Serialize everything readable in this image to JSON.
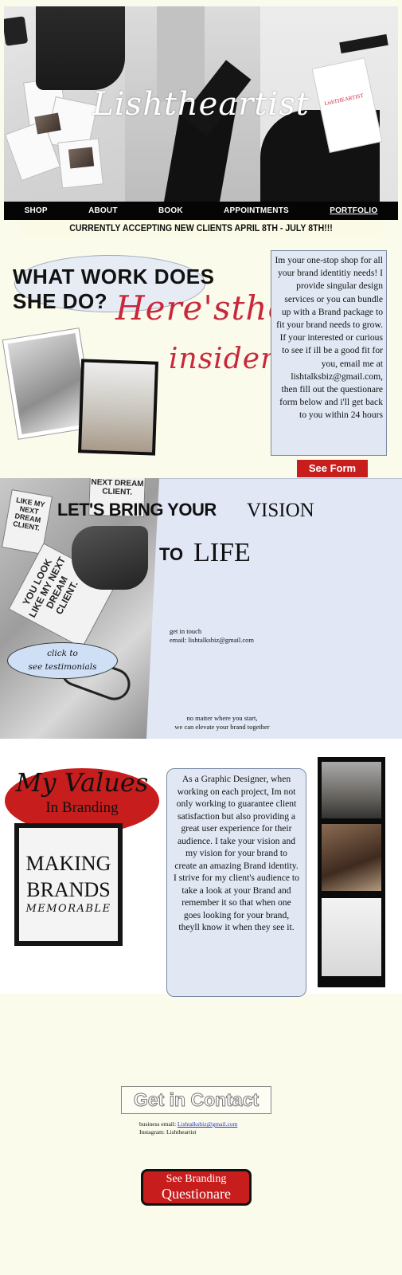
{
  "hero": {
    "title": "Lishtheartist",
    "mock_sign": "LishTHEARTIST"
  },
  "nav": {
    "items": [
      {
        "label": "SHOP"
      },
      {
        "label": "ABOUT"
      },
      {
        "label": "BOOK"
      },
      {
        "label": "APPOINTMENTS"
      },
      {
        "label": "PORTFOLIO"
      }
    ]
  },
  "banner": "CURRENTLY ACCEPTING NEW CLIENTS APRIL 8TH - JULY 8TH!!!",
  "what": {
    "title_line1": "WHAT WORK DOES",
    "title_line2": "SHE DO?",
    "heres": "Here'sthe",
    "insider": "insider!",
    "intro": "Im your one-stop shop for all your brand identitiy needs! I provide singular design services or you can bundle up with a Brand package to fit your brand needs to grow. If your interested or curious to see if ill be a good fit for you, email me at lishtalksbiz@gmail.com, then fill out the questionare form below and i'll get back to you within 24 hours",
    "see_form": "See Form"
  },
  "vision": {
    "line1_bold": "LET'S BRING YOUR",
    "line1_serif": "VISION",
    "to": "TO",
    "life": "LIFE",
    "get_in_touch": "get in touch",
    "email": "email: lishtalksbiz@gmail.com",
    "testimonials_1": "click to",
    "testimonials_2": "see testimonials",
    "elevate_1": "no matter where you start,",
    "elevate_2": "we can elevate your brand together",
    "card_1": "NEXT DREAM CLIENT.",
    "card_2": "YOU LOOK LIKE MY NEXT DREAM CLIENT.",
    "card_3": "LIKE MY NEXT DREAM CLIENT."
  },
  "values": {
    "title": "My Values",
    "subtitle": "In Branding",
    "making": "MAKING",
    "brands": "BRANDS",
    "memorable": "MEMORABLE",
    "body": "As a Graphic Designer, when working on each project, Im not only working to guarantee client satisfaction but also providing a great user experience for their audience. I take your vision and my vision for your brand to create an amazing Brand identity. I strive for my client's audience to take a look at your Brand and remember it so that when one goes looking for your brand, theyll know it when they see it."
  },
  "contact": {
    "title": "Get in Contact",
    "email_label": "business email:",
    "email": "Lishtalksbiz@gmail.com",
    "instagram": "Instagram: Lishtheartist",
    "questionare_1": "See Branding",
    "questionare_2": "Questionare"
  },
  "colors": {
    "accent_red": "#c81d1d",
    "script_red": "#c8283c",
    "panel_blue": "#e1e8f4",
    "cream": "#fbfbeb"
  }
}
